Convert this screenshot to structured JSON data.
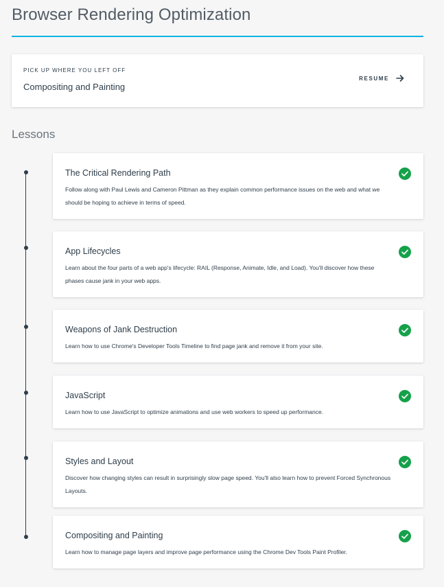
{
  "page": {
    "title": "Browser Rendering Optimization",
    "accent_color": "#02b3e4"
  },
  "resume": {
    "eyebrow": "PICK UP WHERE YOU LEFT OFF",
    "lesson_title": "Compositing and Painting",
    "button_label": "RESUME",
    "button_icon": "arrow-right-icon"
  },
  "lessons_section": {
    "heading": "Lessons",
    "completed_icon": "check-circle-icon",
    "completed_color": "#15a14a",
    "items": [
      {
        "title": "The Critical Rendering Path",
        "description": "Follow along with Paul Lewis and Cameron Pittman as they explain common performance issues on the web and what we should be hoping to achieve in terms of speed.",
        "completed": true
      },
      {
        "title": "App Lifecycles",
        "description": "Learn about the four parts of a web app's lifecycle: RAIL (Response, Animate, Idle, and Load). You'll discover how these phases cause jank in your web apps.",
        "completed": true
      },
      {
        "title": "Weapons of Jank Destruction",
        "description": "Learn how to use Chrome's Developer Tools Timeline to find page jank and remove it from your site.",
        "completed": true
      },
      {
        "title": "JavaScript",
        "description": "Learn how to use JavaScript to optimize animations and use web workers to speed up performance.",
        "completed": true
      },
      {
        "title": "Styles and Layout",
        "description": "Discover how changing styles can result in surprisingly slow page speed. You'll also learn how to prevent Forced Synchronous Layouts.",
        "completed": true
      },
      {
        "title": "Compositing and Painting",
        "description": "Learn how to manage page layers and improve page performance using the Chrome Dev Tools Paint Profiler.",
        "completed": true
      }
    ]
  }
}
